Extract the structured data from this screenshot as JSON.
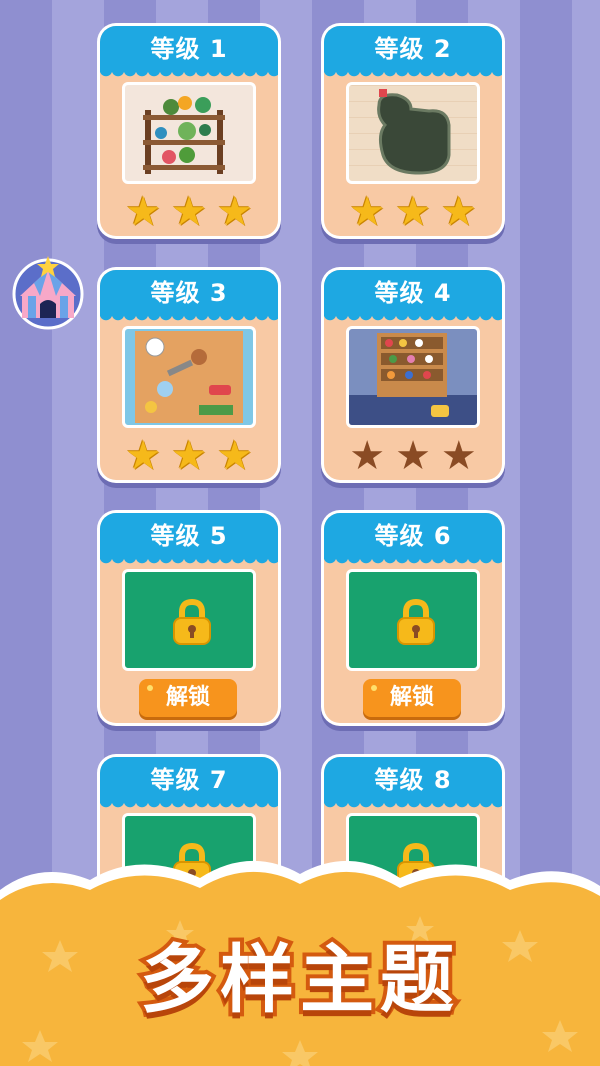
{
  "levels": [
    {
      "label": "等级 1",
      "status": "complete",
      "stars_earned": 3,
      "stars_total": 3,
      "theme": "plant-shelf"
    },
    {
      "label": "等级 2",
      "status": "complete",
      "stars_earned": 3,
      "stars_total": 3,
      "theme": "bathtub-room"
    },
    {
      "label": "等级 3",
      "status": "complete",
      "stars_earned": 3,
      "stars_total": 3,
      "theme": "kitchen-table"
    },
    {
      "label": "等级 4",
      "status": "unlocked",
      "stars_earned": 0,
      "stars_total": 3,
      "theme": "toy-shelf"
    },
    {
      "label": "等级 5",
      "status": "locked",
      "unlock_label": "解锁"
    },
    {
      "label": "等级 6",
      "status": "locked",
      "unlock_label": "解锁"
    },
    {
      "label": "等级 7",
      "status": "locked"
    },
    {
      "label": "等级 8",
      "status": "locked"
    }
  ],
  "side_button": {
    "icon": "circus-tent-icon"
  },
  "banner": {
    "title": "多样主题"
  },
  "colors": {
    "card_header": "#1ea8e2",
    "card_body": "#f8c9a4",
    "locked_thumb": "#18a26e",
    "star_gold": "#f6b91a",
    "star_empty": "#8a4b24",
    "unlock_button": "#f7941d",
    "banner": "#f7b53c"
  }
}
